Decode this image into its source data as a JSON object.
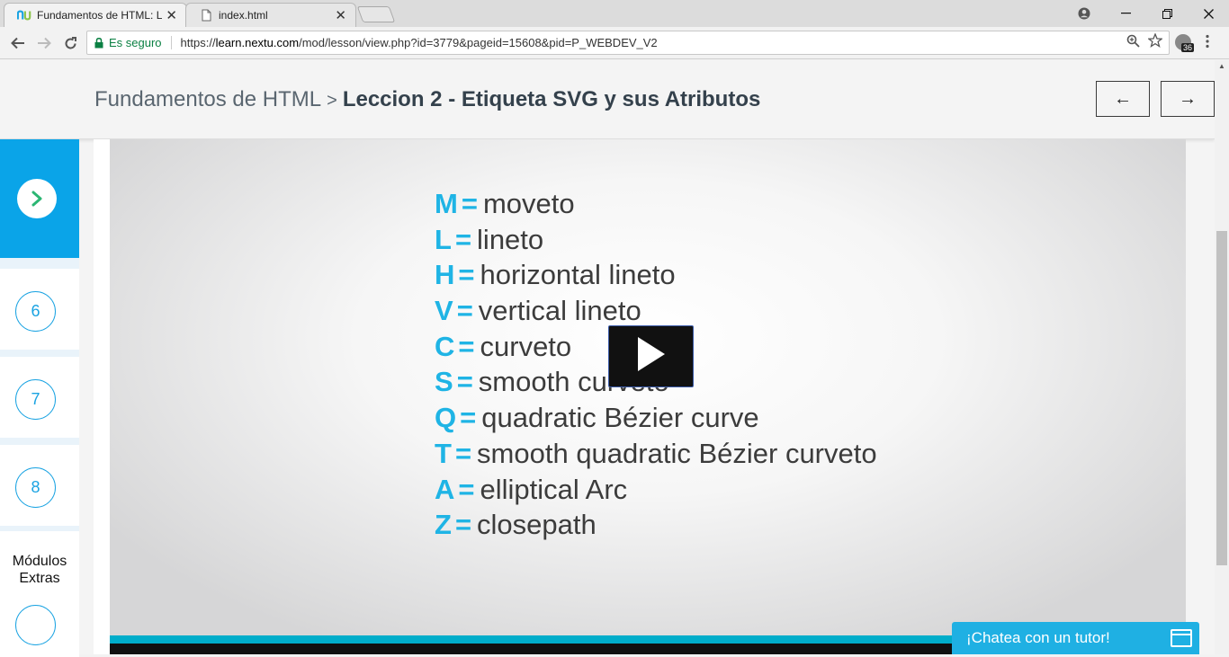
{
  "browser": {
    "tabs": [
      {
        "title": "Fundamentos de HTML: L",
        "active": true
      },
      {
        "title": "index.html",
        "active": false
      }
    ],
    "security_label": "Es seguro",
    "url_prefix": "https://",
    "url_host": "learn.nextu.com",
    "url_path": "/mod/lesson/view.php?id=3779&pageid=15608&pid=P_WEBDEV_V2",
    "extension_badge": "36"
  },
  "header": {
    "course": "Fundamentos de HTML",
    "separator": ">",
    "lesson": "Leccion 2 - Etiqueta SVG y sus Atributos",
    "prev_label": "←",
    "next_label": "→"
  },
  "sidebar": {
    "items": [
      {
        "label": "6"
      },
      {
        "label": "7"
      },
      {
        "label": "8"
      }
    ],
    "extras_label_1": "Módulos",
    "extras_label_2": "Extras"
  },
  "video": {
    "commands": [
      {
        "key": "M",
        "eq": "=",
        "text": "moveto"
      },
      {
        "key": "L",
        "eq": "=",
        "text": "lineto"
      },
      {
        "key": "H",
        "eq": "=",
        "text": "horizontal lineto"
      },
      {
        "key": "V",
        "eq": "=",
        "text": "vertical lineto"
      },
      {
        "key": "C",
        "eq": "=",
        "text": "curveto"
      },
      {
        "key": "S",
        "eq": "=",
        "text": "smooth curveto"
      },
      {
        "key": "Q",
        "eq": "=",
        "text": "quadratic Bézier curve"
      },
      {
        "key": "T",
        "eq": "=",
        "text": "smooth quadratic Bézier curveto"
      },
      {
        "key": "A",
        "eq": "=",
        "text": "elliptical Arc"
      },
      {
        "key": "Z",
        "eq": "=",
        "text": "closepath"
      }
    ]
  },
  "chat": {
    "label": "¡Chatea con un tutor!"
  },
  "colors": {
    "accent": "#0aa4e8",
    "key": "#1fb4e5",
    "secure": "#0b8043"
  }
}
